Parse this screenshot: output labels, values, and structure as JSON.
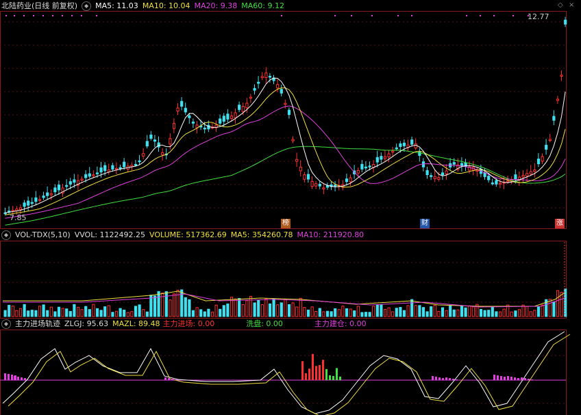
{
  "price_panel": {
    "stock_name": "北陆药业",
    "period": "(日线 前复权)",
    "ma5_label": "MA5: 11.03",
    "ma10_label": "MA10: 10.04",
    "ma20_label": "MA20: 9.38",
    "ma60_label": "MA60: 9.12",
    "high_label": "12.77",
    "low_label": "7.85",
    "event_tags": [
      {
        "text": "榜",
        "color": "#b05a20"
      },
      {
        "text": "财",
        "color": "#2255aa"
      },
      {
        "text": "涨",
        "color": "#cc3333"
      }
    ],
    "colors": {
      "ma5": "#ffffff",
      "ma10": "#f0e040",
      "ma20": "#e040e0",
      "ma60": "#40e040",
      "up": "#ff3030",
      "down": "#40e0f0"
    }
  },
  "volume_panel": {
    "indicator": "VOL-TDX(5,10)",
    "vvol_label": "VVOL: 1122492.25",
    "volume_label": "VOLUME: 517362.69",
    "ma5_label": "MA5: 354260.78",
    "ma10_label": "MA10: 211920.80"
  },
  "track_panel": {
    "indicator": "主力进场轨迹",
    "zlgj_label": "ZLGJ: 95.63",
    "mazl_label": "MAZL: 89.48",
    "enter_label": "主力进场: 0.00",
    "wash_label": "洗盘: 0.00",
    "build_label": "主力建仓: 0.00"
  },
  "chart_data": {
    "type": "candlestick",
    "price_range": [
      7.85,
      12.77
    ],
    "ma_current": {
      "MA5": 11.03,
      "MA10": 10.04,
      "MA20": 9.38,
      "MA60": 9.12
    },
    "volume_current": {
      "VVOL": 1122492.25,
      "VOLUME": 517362.69,
      "MA5": 354260.78,
      "MA10": 211920.8
    },
    "track_current": {
      "ZLGJ": 95.63,
      "MAZL": 89.48
    }
  }
}
